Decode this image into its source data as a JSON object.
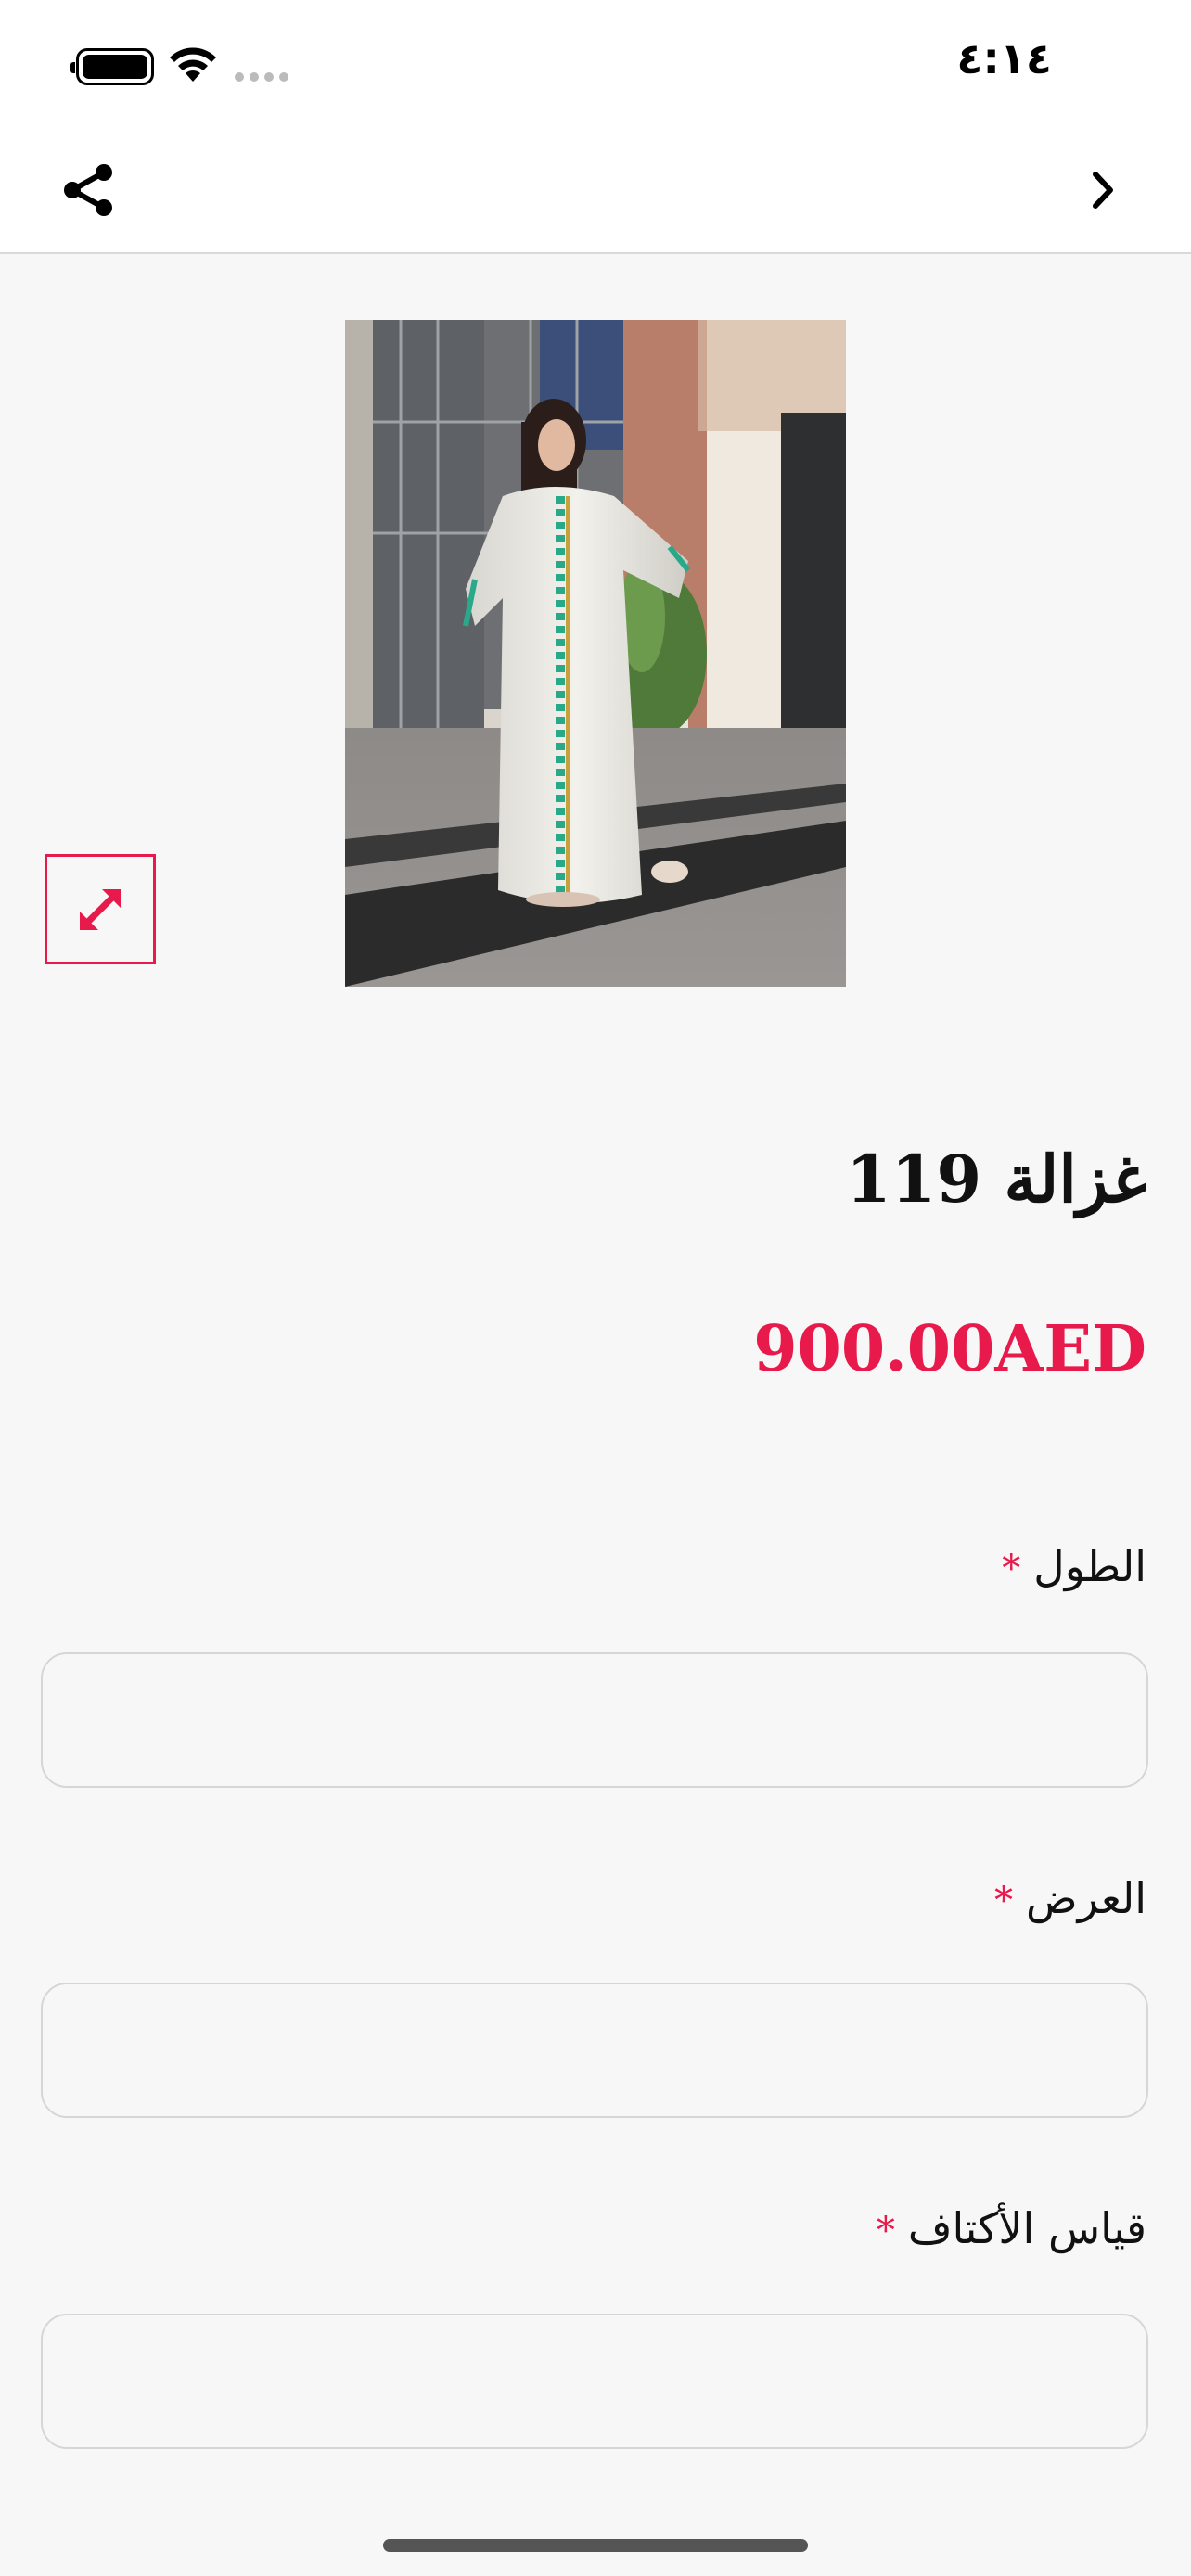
{
  "status_bar": {
    "time": "٤:١٤"
  },
  "nav": {
    "share_icon": "share-icon",
    "back_icon": "chevron-right-icon"
  },
  "product": {
    "image_icon": "product-photo",
    "expand_icon": "expand-icon",
    "title": "غزالة 119",
    "price": "900.00AED"
  },
  "fields": [
    {
      "label": "الطول",
      "required_mark": "*",
      "value": "",
      "placeholder": ""
    },
    {
      "label": "العرض",
      "required_mark": "*",
      "value": "",
      "placeholder": ""
    },
    {
      "label": "قياس الأكتاف",
      "required_mark": "*",
      "value": "",
      "placeholder": ""
    }
  ],
  "colors": {
    "accent": "#e8194b",
    "background": "#f7f7f7",
    "text": "#111111"
  }
}
